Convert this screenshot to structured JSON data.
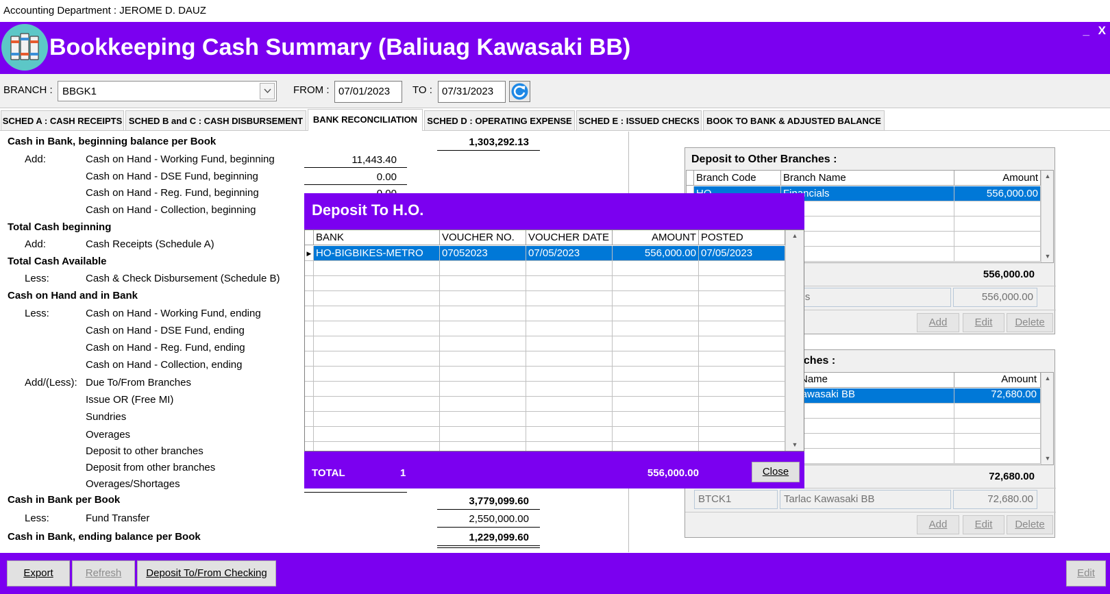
{
  "window": {
    "caption": "Accounting Department : JEROME D. DAUZ",
    "title": "Bookkeeping Cash Summary (Baliuag Kawasaki BB)",
    "minimize": "_",
    "close": "X"
  },
  "filters": {
    "branch_label": "BRANCH :",
    "branch_value": "BBGK1",
    "from_label": "FROM :",
    "from_value": "07/01/2023",
    "to_label": "TO :",
    "to_value": "07/31/2023"
  },
  "tabs": [
    {
      "label": "SCHED A : CASH RECEIPTS"
    },
    {
      "label": "SCHED B and C : CASH DISBURSEMENT"
    },
    {
      "label": "BANK RECONCILIATION"
    },
    {
      "label": "SCHED D : OPERATING EXPENSE"
    },
    {
      "label": "SCHED E : ISSUED CHECKS"
    },
    {
      "label": "BOOK TO BANK & ADJUSTED BALANCE"
    }
  ],
  "report": {
    "beginning_book": {
      "label": "Cash in Bank, beginning balance per Book",
      "amount": "1,303,292.13"
    },
    "add1": "Add:",
    "working_fund_begin": {
      "label": "Cash on Hand - Working Fund, beginning",
      "amount": "11,443.40"
    },
    "dse_fund_begin": {
      "label": "Cash on Hand - DSE Fund, beginning",
      "amount": "0.00"
    },
    "reg_fund_begin": {
      "label": "Cash on Hand - Reg. Fund, beginning",
      "amount": "0.00"
    },
    "collection_begin": {
      "label": "Cash on Hand - Collection, beginning"
    },
    "total_cash_begin": "Total Cash beginning",
    "add2": "Add:",
    "cash_receipts": "Cash Receipts (Schedule A)",
    "total_cash_available": "Total Cash Available",
    "less1": "Less:",
    "disbursement": "Cash & Check Disbursement (Schedule B)",
    "cash_on_hand_bank": "Cash on Hand and in Bank",
    "less2": "Less:",
    "working_fund_end": "Cash on Hand - Working Fund, ending",
    "dse_fund_end": "Cash on Hand - DSE Fund, ending",
    "reg_fund_end": "Cash on Hand - Reg. Fund, ending",
    "collection_end": "Cash on Hand - Collection, ending",
    "add_less": "Add/(Less):",
    "due_to_from": "Due To/From Branches",
    "issue_or": "Issue OR (Free MI)",
    "sundries": "Sundries",
    "overages": "Overages",
    "deposit_to_other": "Deposit to other branches",
    "deposit_from_other": "Deposit from other branches",
    "overages_shortages": "Overages/Shortages",
    "cash_in_bank_book": {
      "label": "Cash in Bank per Book",
      "amount": "3,779,099.60"
    },
    "less3": "Less:",
    "fund_transfer": {
      "label": "Fund Transfer",
      "amount": "2,550,000.00"
    },
    "ending_book": {
      "label": "Cash in Bank, ending balance per Book",
      "amount": "1,229,099.60"
    }
  },
  "deposit_to_other_branches": {
    "title": "Deposit to Other Branches :",
    "columns": [
      "Branch Code",
      "Branch Name",
      "Amount"
    ],
    "rows": [
      {
        "code": "HO",
        "name": "Financials",
        "amount": "556,000.00"
      }
    ],
    "total": "556,000.00",
    "detail_name": "ncials",
    "detail_amount": "556,000.00",
    "add": "Add",
    "edit": "Edit",
    "delete": "Delete"
  },
  "deposit_from_other_branches": {
    "title": "ranches :",
    "columns": [
      "ch Name",
      "Amount"
    ],
    "rows": [
      {
        "name": "c Kawasaki BB",
        "amount": "72,680.00"
      }
    ],
    "total": "72,680.00",
    "detail_code": "BTCK1",
    "detail_name": "Tarlac Kawasaki BB",
    "detail_amount": "72,680.00",
    "add": "Add",
    "edit": "Edit",
    "delete": "Delete"
  },
  "modal": {
    "title": "Deposit To H.O.",
    "columns": [
      "BANK",
      "VOUCHER NO.",
      "VOUCHER DATE",
      "AMOUNT",
      "POSTED"
    ],
    "rows": [
      {
        "bank": "HO-BIGBIKES-METRO",
        "voucher_no": "07052023",
        "voucher_date": "07/05/2023",
        "amount": "556,000.00",
        "posted": "07/05/2023"
      }
    ],
    "total_label": "TOTAL",
    "total_count": "1",
    "total_amount": "556,000.00",
    "close": "Close"
  },
  "bottom": {
    "export": "Export",
    "refresh": "Refresh",
    "deposit_checking": "Deposit To/From Checking",
    "edit": "Edit"
  },
  "colors": {
    "brand_purple": "#7b00f0",
    "selection_blue": "#0078d7"
  }
}
